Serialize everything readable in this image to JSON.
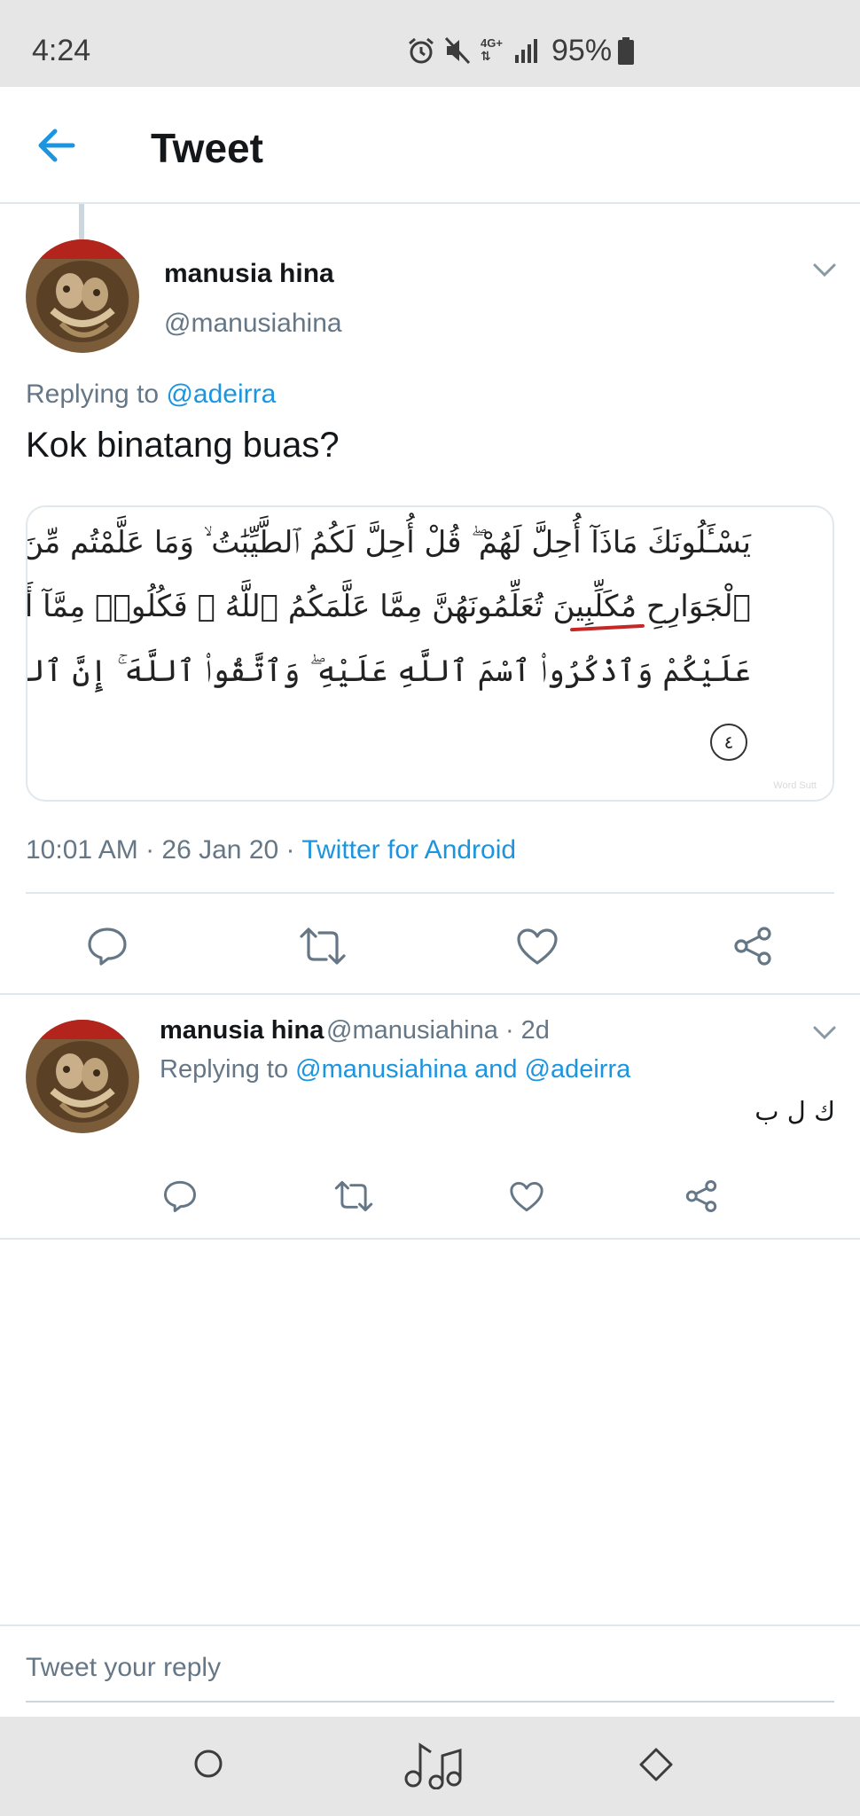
{
  "status_bar": {
    "time": "4:24",
    "network": "4G+",
    "battery": "95%",
    "icons": [
      "alarm-icon",
      "mute-icon",
      "network-4g-icon",
      "signal-icon",
      "battery-icon"
    ]
  },
  "header": {
    "title": "Tweet",
    "back_icon": "arrow-left-icon"
  },
  "tweet": {
    "author_name": "manusia hina",
    "author_handle": "@manusiahina",
    "replying_prefix": "Replying to ",
    "replying_to": "@adeirra",
    "text": "Kok binatang buas?",
    "media": {
      "lines": [
        "يَسْـَٔلُونَكَ مَاذَآ أُحِلَّ لَهُمْ ۖ قُلْ أُحِلَّ لَكُمُ ٱلطَّيِّبَٰتُ ۙ وَمَا عَلَّمْتُم مِّنَ",
        "ٱلْجَوَارِحِ مُكَلِّبِينَ تُعَلِّمُونَهُنَّ مِمَّا عَلَّمَكُمُ ٱللَّهُ ۖ فَكُلُوا۟ مِمَّآ أَمْسَكْنَ",
        "عَلَيْكُمْ وَٱذْكُرُوا۟ ٱسْمَ ٱللَّهِ عَلَيْهِ ۖ وَٱتَّقُوا۟ ٱللَّهَ ۚ إِنَّ ٱللَّهَ سَرِيعُ ٱلْحِسَابِ"
      ],
      "verse_number": "٤",
      "watermark": "Word Sutt",
      "underline_color": "#c62828"
    },
    "timestamp": "10:01 AM · 26 Jan 20 · ",
    "source": "Twitter for Android"
  },
  "actions": [
    "reply-icon",
    "retweet-icon",
    "like-icon",
    "share-icon"
  ],
  "reply": {
    "author_name": "manusia hina",
    "author_handle": "@manusiahina · 2d",
    "replying_prefix": "Replying to ",
    "replying_to": "@manusiahina and @adeirra",
    "text": "ك ل ب"
  },
  "compose": {
    "placeholder": "Tweet your reply"
  },
  "navbar": [
    "home-circle-icon",
    "music-notes-icon",
    "diamond-back-icon"
  ],
  "colors": {
    "accent": "#1b95e0",
    "secondary_text": "#657786",
    "divider": "#e1e8ed",
    "system_bar": "#e6e6e6"
  }
}
